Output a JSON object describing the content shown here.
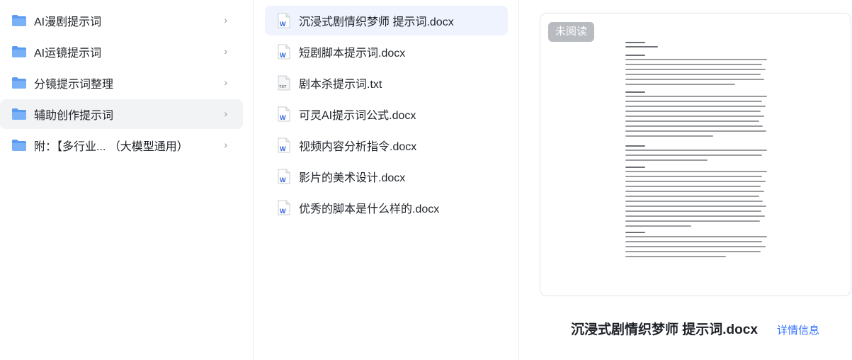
{
  "folders": [
    {
      "label": "AI漫剧提示词"
    },
    {
      "label": "AI运镜提示词"
    },
    {
      "label": "分镜提示词整理"
    },
    {
      "label": "辅助创作提示词"
    },
    {
      "label": "附：【多行业...  （大模型通用）"
    }
  ],
  "files": [
    {
      "label": "沉浸式剧情织梦师 提示词.docx",
      "type": "docx"
    },
    {
      "label": "短剧脚本提示词.docx",
      "type": "docx"
    },
    {
      "label": "剧本杀提示词.txt",
      "type": "txt"
    },
    {
      "label": "可灵AI提示词公式.docx",
      "type": "docx"
    },
    {
      "label": "视频内容分析指令.docx",
      "type": "docx"
    },
    {
      "label": "影片的美术设计.docx",
      "type": "docx"
    },
    {
      "label": "优秀的脚本是什么样的.docx",
      "type": "docx"
    }
  ],
  "preview": {
    "badge": "未阅读",
    "title": "沉浸式剧情织梦师 提示词.docx",
    "detail_link": "详情信息"
  },
  "colors": {
    "folder_blue": "#5b9bf0",
    "word_blue": "#2b5fd9",
    "link_blue": "#3370ff"
  },
  "icons": {
    "folder": "folder-icon",
    "chevron": "chevron-right-icon",
    "docx": "word-doc-icon",
    "txt": "txt-file-icon"
  }
}
